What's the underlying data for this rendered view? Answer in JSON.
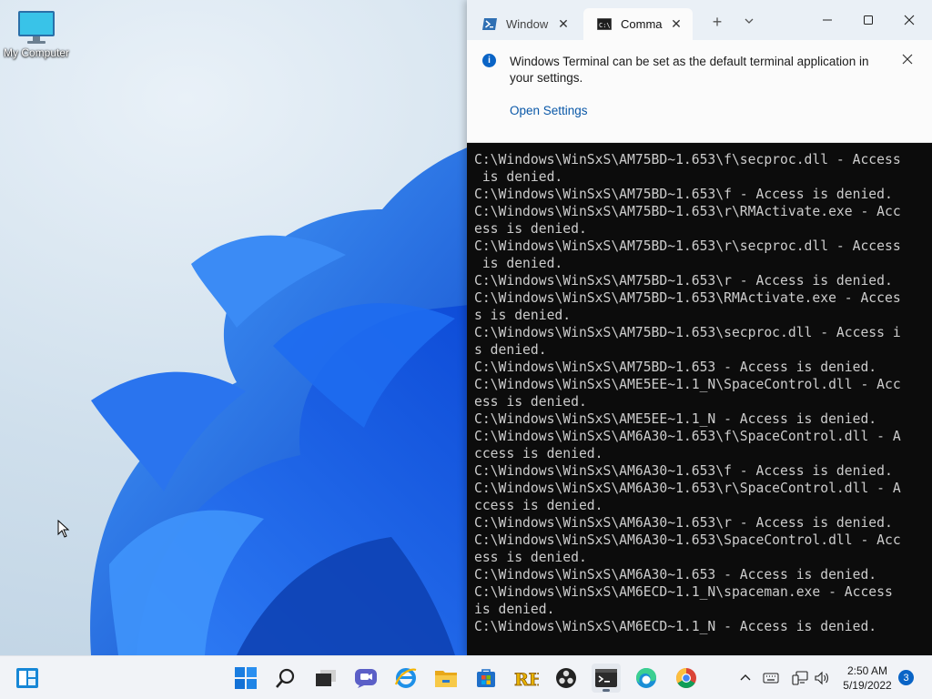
{
  "desktop": {
    "icons": [
      {
        "label": "My Computer",
        "icon": "monitor-icon"
      }
    ]
  },
  "terminal": {
    "tabs": [
      {
        "label": "Window",
        "icon": "powershell-icon",
        "close": "✕",
        "active": false
      },
      {
        "label": "Comma",
        "icon": "cmd-icon",
        "close": "✕",
        "active": true
      }
    ],
    "new_tab": "+",
    "infobar": {
      "message": "Windows Terminal can be set as the default terminal application in your settings.",
      "link": "Open Settings",
      "icon_glyph": "i"
    },
    "console_lines": [
      "C:\\Windows\\WinSxS\\AM75BD~1.653\\f\\secproc.dll - Access",
      " is denied.",
      "C:\\Windows\\WinSxS\\AM75BD~1.653\\f - Access is denied.",
      "C:\\Windows\\WinSxS\\AM75BD~1.653\\r\\RMActivate.exe - Acc",
      "ess is denied.",
      "C:\\Windows\\WinSxS\\AM75BD~1.653\\r\\secproc.dll - Access",
      " is denied.",
      "C:\\Windows\\WinSxS\\AM75BD~1.653\\r - Access is denied.",
      "C:\\Windows\\WinSxS\\AM75BD~1.653\\RMActivate.exe - Acces",
      "s is denied.",
      "C:\\Windows\\WinSxS\\AM75BD~1.653\\secproc.dll - Access i",
      "s denied.",
      "C:\\Windows\\WinSxS\\AM75BD~1.653 - Access is denied.",
      "C:\\Windows\\WinSxS\\AME5EE~1.1_N\\SpaceControl.dll - Acc",
      "ess is denied.",
      "C:\\Windows\\WinSxS\\AME5EE~1.1_N - Access is denied.",
      "C:\\Windows\\WinSxS\\AM6A30~1.653\\f\\SpaceControl.dll - A",
      "ccess is denied.",
      "C:\\Windows\\WinSxS\\AM6A30~1.653\\f - Access is denied.",
      "C:\\Windows\\WinSxS\\AM6A30~1.653\\r\\SpaceControl.dll - A",
      "ccess is denied.",
      "C:\\Windows\\WinSxS\\AM6A30~1.653\\r - Access is denied.",
      "C:\\Windows\\WinSxS\\AM6A30~1.653\\SpaceControl.dll - Acc",
      "ess is denied.",
      "C:\\Windows\\WinSxS\\AM6A30~1.653 - Access is denied.",
      "C:\\Windows\\WinSxS\\AM6ECD~1.1_N\\spaceman.exe - Access",
      "is denied.",
      "C:\\Windows\\WinSxS\\AM6ECD~1.1_N - Access is denied."
    ]
  },
  "taskbar": {
    "apps": [
      {
        "name": "widgets-icon",
        "active": false
      },
      {
        "name": "start-icon",
        "active": false
      },
      {
        "name": "search-icon",
        "active": false
      },
      {
        "name": "task-view-icon",
        "active": false
      },
      {
        "name": "chat-icon",
        "active": false
      },
      {
        "name": "internet-explorer-icon",
        "active": false
      },
      {
        "name": "file-explorer-icon",
        "active": false
      },
      {
        "name": "store-icon",
        "active": false
      },
      {
        "name": "rh-app-icon",
        "active": false
      },
      {
        "name": "obs-icon",
        "active": false
      },
      {
        "name": "terminal-icon",
        "active": true
      },
      {
        "name": "edge-icon",
        "active": false
      },
      {
        "name": "chrome-icon",
        "active": false
      }
    ],
    "rh_label": "RH",
    "tray_icons": [
      "chevron-up-icon",
      "keyboard-icon",
      "network-icon",
      "volume-icon"
    ],
    "time": "2:50 AM",
    "date": "5/19/2022",
    "notification_count": "3"
  },
  "colors": {
    "accent": "#0a64c6",
    "console_bg": "#0c0c0c",
    "console_fg": "#cccccc",
    "bloom_blue": "#1466e6"
  }
}
